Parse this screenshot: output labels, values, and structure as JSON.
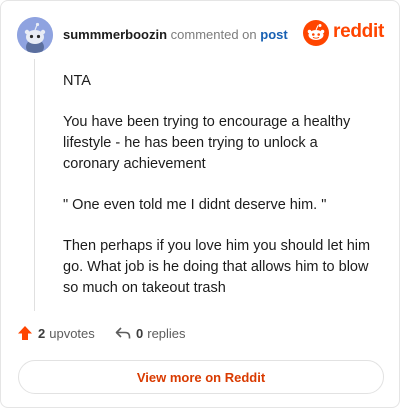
{
  "comment": {
    "author": "summmerboozin",
    "action_text": "commented on",
    "post_link": "post",
    "paragraphs": [
      "NTA",
      "You have been trying to encourage a healthy lifestyle - he has been trying to unlock a coronary achievement",
      "\" One even told me I didnt deserve him. \"",
      "Then perhaps if you love him you should let him go. What job is he doing that allows him to blow so much on takeout trash"
    ]
  },
  "brand": {
    "logo_text": "reddit",
    "accent": "#ff4500"
  },
  "footer": {
    "upvotes_count": "2",
    "upvotes_label": "upvotes",
    "replies_count": "0",
    "replies_label": "replies"
  },
  "view_more_label": "View more on Reddit",
  "icons": [
    "avatar-snoo-icon",
    "reddit-logo-icon",
    "upvote-arrow-icon",
    "reply-arrow-icon"
  ]
}
